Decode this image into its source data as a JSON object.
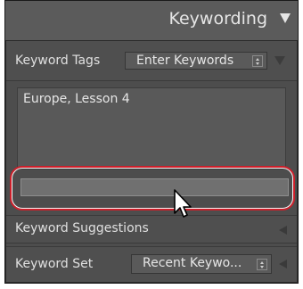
{
  "header": {
    "title": "Keywording"
  },
  "keyword_tags": {
    "label": "Keyword Tags",
    "select_value": "Enter Keywords"
  },
  "tags_text": "Europe, Lesson 4",
  "keyword_entry": {
    "value": ""
  },
  "keyword_suggestions": {
    "label": "Keyword Suggestions"
  },
  "keyword_set": {
    "label": "Keyword Set",
    "select_value": "Recent Keywo..."
  },
  "colors": {
    "panel": "#4d4d4d",
    "header": "#5b5b5b",
    "callout": "#cc1f2a"
  },
  "icons": [
    "disclosure-triangle-down-icon",
    "stepper-icon",
    "collapse-triangle-left-icon",
    "mouse-cursor-icon"
  ]
}
